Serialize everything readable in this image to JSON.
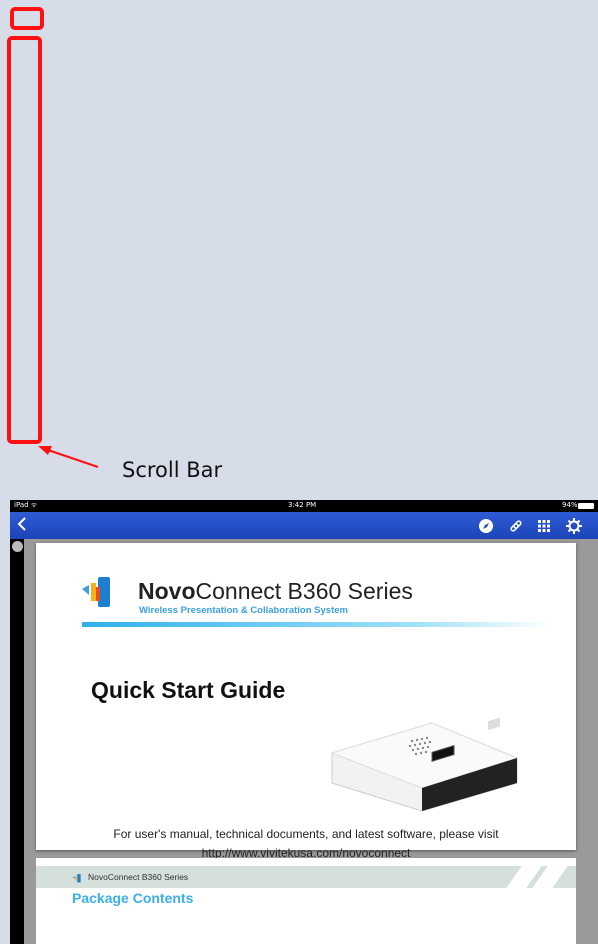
{
  "annotation": {
    "label": "Scroll Bar",
    "highlight_color": "#ff1010"
  },
  "status_bar": {
    "device": "iPad ᯤ",
    "time": "3:42 PM",
    "battery": "94%"
  },
  "nav_bar": {
    "back_icon": "chevron-left-icon",
    "icons": [
      "compass-icon",
      "link-icon",
      "grid-icon",
      "gear-icon"
    ],
    "color": "#2448c4"
  },
  "document": {
    "brand_bold": "Novo",
    "brand_rest": "Connect B360 Series",
    "tagline": "Wireless Presentation & Collaboration System",
    "title": "Quick Start Guide",
    "visit_text": "For user's manual, technical documents, and latest software, please visit",
    "url": "http://www.vivitekusa.com/novoconnect",
    "page2_header": "NovoConnect B360 Series",
    "page2_heading": "Package Contents"
  }
}
